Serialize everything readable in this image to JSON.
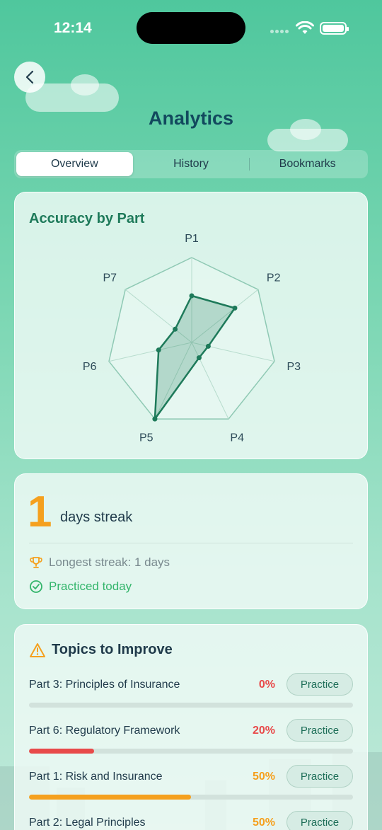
{
  "status_bar": {
    "time": "12:14"
  },
  "header": {
    "title": "Analytics"
  },
  "tabs": [
    {
      "label": "Overview",
      "active": true
    },
    {
      "label": "History",
      "active": false
    },
    {
      "label": "Bookmarks",
      "active": false
    }
  ],
  "accuracy": {
    "title": "Accuracy by Part",
    "chart_data": {
      "type": "radar",
      "categories": [
        "P1",
        "P2",
        "P3",
        "P4",
        "P5",
        "P6",
        "P7"
      ],
      "values": [
        0.55,
        0.65,
        0.2,
        0.2,
        1.0,
        0.4,
        0.25
      ],
      "range": [
        0,
        1
      ],
      "grid": true
    }
  },
  "streak": {
    "count": "1",
    "label": "days streak",
    "longest": "Longest streak: 1 days",
    "today": "Practiced today"
  },
  "topics": {
    "title": "Topics to Improve",
    "items": [
      {
        "name": "Part 3: Principles of Insurance",
        "percent_label": "0%",
        "percent": 0,
        "color": "#e84a4a",
        "action": "Practice"
      },
      {
        "name": "Part 6: Regulatory Framework",
        "percent_label": "20%",
        "percent": 20,
        "color": "#e84a4a",
        "action": "Practice"
      },
      {
        "name": "Part 1: Risk and Insurance",
        "percent_label": "50%",
        "percent": 50,
        "color": "#f5a01e",
        "action": "Practice"
      },
      {
        "name": "Part 2: Legal Principles",
        "percent_label": "50%",
        "percent": 50,
        "color": "#f5a01e",
        "action": "Practice"
      }
    ]
  },
  "colors": {
    "accent": "#1e7a5a",
    "title": "#12495e",
    "streak": "#f5a01e",
    "success": "#33b56b"
  }
}
